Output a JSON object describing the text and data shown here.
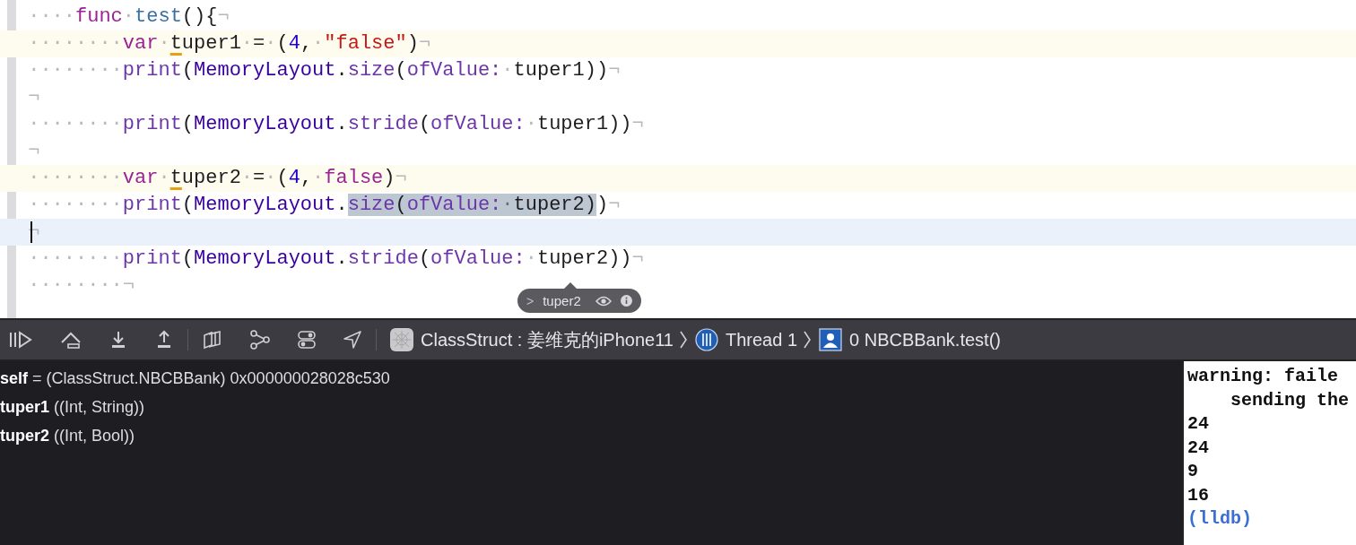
{
  "editor": {
    "lines": [
      {
        "kind": "plain",
        "tokens": [
          {
            "kind": "invisible",
            "text": "····"
          },
          {
            "kind": "keyword",
            "text": "func"
          },
          {
            "kind": "invisible",
            "text": "·"
          },
          {
            "kind": "function",
            "text": "test"
          },
          {
            "kind": "plain",
            "text": "(){"
          },
          {
            "kind": "invisible",
            "text": "¬"
          }
        ]
      },
      {
        "kind": "warning",
        "tokens": [
          {
            "kind": "invisible",
            "text": "········"
          },
          {
            "kind": "keyword",
            "text": "var"
          },
          {
            "kind": "invisible",
            "text": "·"
          },
          {
            "kind": "squiggle",
            "text": "t"
          },
          {
            "kind": "plain",
            "text": "uper1"
          },
          {
            "kind": "invisible",
            "text": "·"
          },
          {
            "kind": "plain",
            "text": "="
          },
          {
            "kind": "invisible",
            "text": "·"
          },
          {
            "kind": "plain",
            "text": "("
          },
          {
            "kind": "number",
            "text": "4"
          },
          {
            "kind": "plain",
            "text": ","
          },
          {
            "kind": "invisible",
            "text": "·"
          },
          {
            "kind": "string",
            "text": "\"false\""
          },
          {
            "kind": "plain",
            "text": ")"
          },
          {
            "kind": "invisible",
            "text": "¬"
          }
        ]
      },
      {
        "kind": "plain",
        "tokens": [
          {
            "kind": "invisible",
            "text": "········"
          },
          {
            "kind": "call",
            "text": "print"
          },
          {
            "kind": "plain",
            "text": "("
          },
          {
            "kind": "type",
            "text": "MemoryLayout"
          },
          {
            "kind": "plain",
            "text": "."
          },
          {
            "kind": "call",
            "text": "size"
          },
          {
            "kind": "plain",
            "text": "("
          },
          {
            "kind": "param",
            "text": "ofValue:"
          },
          {
            "kind": "invisible",
            "text": "·"
          },
          {
            "kind": "plain",
            "text": "tuper1))"
          },
          {
            "kind": "invisible",
            "text": "¬"
          }
        ]
      },
      {
        "kind": "plain",
        "tokens": [
          {
            "kind": "invisible",
            "text": "¬"
          }
        ]
      },
      {
        "kind": "plain",
        "tokens": [
          {
            "kind": "invisible",
            "text": "········"
          },
          {
            "kind": "call",
            "text": "print"
          },
          {
            "kind": "plain",
            "text": "("
          },
          {
            "kind": "type",
            "text": "MemoryLayout"
          },
          {
            "kind": "plain",
            "text": "."
          },
          {
            "kind": "call",
            "text": "stride"
          },
          {
            "kind": "plain",
            "text": "("
          },
          {
            "kind": "param",
            "text": "ofValue:"
          },
          {
            "kind": "invisible",
            "text": "·"
          },
          {
            "kind": "plain",
            "text": "tuper1))"
          },
          {
            "kind": "invisible",
            "text": "¬"
          }
        ]
      },
      {
        "kind": "plain",
        "tokens": [
          {
            "kind": "invisible",
            "text": "¬"
          }
        ]
      },
      {
        "kind": "warning",
        "tokens": [
          {
            "kind": "invisible",
            "text": "········"
          },
          {
            "kind": "keyword",
            "text": "var"
          },
          {
            "kind": "invisible",
            "text": "·"
          },
          {
            "kind": "squiggle",
            "text": "t"
          },
          {
            "kind": "plain",
            "text": "uper2"
          },
          {
            "kind": "invisible",
            "text": "·"
          },
          {
            "kind": "plain",
            "text": "="
          },
          {
            "kind": "invisible",
            "text": "·"
          },
          {
            "kind": "plain",
            "text": "("
          },
          {
            "kind": "number",
            "text": "4"
          },
          {
            "kind": "plain",
            "text": ","
          },
          {
            "kind": "invisible",
            "text": "·"
          },
          {
            "kind": "keyword",
            "text": "false"
          },
          {
            "kind": "plain",
            "text": ")"
          },
          {
            "kind": "invisible",
            "text": "¬"
          }
        ]
      },
      {
        "kind": "plain",
        "tokens": [
          {
            "kind": "invisible",
            "text": "········",
            "matched": false
          },
          {
            "kind": "call",
            "text": "print",
            "matched": false
          },
          {
            "kind": "plain",
            "text": "(",
            "matched": false
          },
          {
            "kind": "type",
            "text": "MemoryLayout",
            "matched": false
          },
          {
            "kind": "plain",
            "text": ".",
            "matched": false
          },
          {
            "kind": "call",
            "text": "size",
            "matched": true
          },
          {
            "kind": "plain",
            "text": "(",
            "matched": true
          },
          {
            "kind": "param",
            "text": "ofValue:",
            "matched": true
          },
          {
            "kind": "invisible",
            "text": "·",
            "matched": true
          },
          {
            "kind": "plain",
            "text": "tuper2)",
            "matched": true
          },
          {
            "kind": "plain",
            "text": ")",
            "matched": false
          },
          {
            "kind": "invisible",
            "text": "¬",
            "matched": false
          }
        ]
      },
      {
        "kind": "cursor",
        "tokens": [
          {
            "kind": "invisible",
            "text": "¬"
          }
        ]
      },
      {
        "kind": "plain",
        "tokens": [
          {
            "kind": "invisible",
            "text": "········"
          },
          {
            "kind": "call",
            "text": "print"
          },
          {
            "kind": "plain",
            "text": "("
          },
          {
            "kind": "type",
            "text": "MemoryLayout"
          },
          {
            "kind": "plain",
            "text": "."
          },
          {
            "kind": "call",
            "text": "stride"
          },
          {
            "kind": "plain",
            "text": "("
          },
          {
            "kind": "param",
            "text": "ofValue:"
          },
          {
            "kind": "invisible",
            "text": "·"
          },
          {
            "kind": "plain",
            "text": "tuper2))"
          },
          {
            "kind": "invisible",
            "text": "¬"
          }
        ]
      },
      {
        "kind": "plain",
        "tokens": [
          {
            "kind": "invisible",
            "text": "········¬"
          }
        ]
      }
    ],
    "tooltip": {
      "chevron": ">",
      "label": "tuper2"
    }
  },
  "debug_bar": {
    "scheme": "ClassStruct : 姜维克的iPhone11",
    "thread": "Thread 1",
    "frame": "0 NBCBBank.test()"
  },
  "variables": [
    {
      "name": "self",
      "detail": "= (ClassStruct.NBCBBank) 0x000000028028c530"
    },
    {
      "name": "tuper1",
      "detail": "((Int, String))"
    },
    {
      "name": "tuper2",
      "detail": "((Int, Bool))"
    }
  ],
  "console": {
    "lines": [
      {
        "kind": "output",
        "text": "warning: faile"
      },
      {
        "kind": "output",
        "text": "    sending the"
      },
      {
        "kind": "output",
        "text": "24"
      },
      {
        "kind": "output",
        "text": "24"
      },
      {
        "kind": "output",
        "text": "9"
      },
      {
        "kind": "output",
        "text": "16"
      },
      {
        "kind": "prompt",
        "text": "(lldb)"
      }
    ]
  }
}
